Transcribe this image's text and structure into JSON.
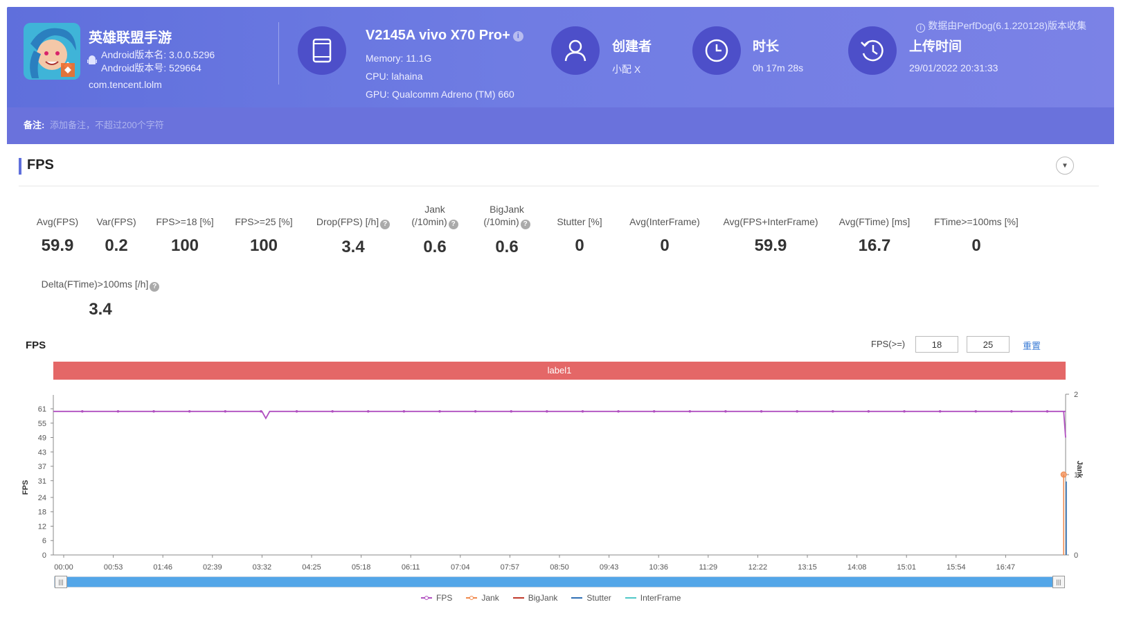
{
  "header": {
    "top_note": "数据由PerfDog(6.1.220128)版本收集",
    "app": {
      "name": "英雄联盟手游",
      "version_name": "Android版本名: 3.0.0.5296",
      "version_code": "Android版本号: 529664",
      "package": "com.tencent.lolm"
    },
    "device": {
      "name": "V2145A vivo X70 Pro+",
      "memory": "Memory: 11.1G",
      "cpu": "CPU: lahaina",
      "gpu": "GPU: Qualcomm Adreno (TM) 660"
    },
    "creator": {
      "title": "创建者",
      "value": "小配 X"
    },
    "duration": {
      "title": "时长",
      "value": "0h 17m 28s"
    },
    "upload": {
      "title": "上传时间",
      "value": "29/01/2022 20:31:33"
    },
    "remark_label": "备注:",
    "remark_placeholder": "添加备注，不超过200个字符"
  },
  "section": {
    "title": "FPS"
  },
  "metrics": [
    {
      "label": "Avg(FPS)",
      "value": "59.9"
    },
    {
      "label": "Var(FPS)",
      "value": "0.2"
    },
    {
      "label": "FPS>=18 [%]",
      "value": "100"
    },
    {
      "label": "FPS>=25 [%]",
      "value": "100"
    },
    {
      "label": "Drop(FPS) [/h]",
      "value": "3.4"
    },
    {
      "label": "Jank",
      "label2": "(/10min)",
      "value": "0.6"
    },
    {
      "label": "BigJank",
      "label2": "(/10min)",
      "value": "0.6"
    },
    {
      "label": "Stutter [%]",
      "value": "0"
    },
    {
      "label": "Avg(InterFrame)",
      "value": "0"
    },
    {
      "label": "Avg(FPS+InterFrame)",
      "value": "59.9"
    },
    {
      "label": "Avg(FTime) [ms]",
      "value": "16.7"
    },
    {
      "label": "FTime>=100ms [%]",
      "value": "0"
    },
    {
      "label": "Delta(FTime)>100ms [/h]",
      "value": "3.4"
    }
  ],
  "chart_panel": {
    "title": "FPS",
    "filter_label": "FPS(>=)",
    "filter_values": [
      "18",
      "25"
    ],
    "reset": "重置",
    "band_label": "label1"
  },
  "chart_data": {
    "type": "line",
    "ylabel": "FPS",
    "ylabel_right": "Jank",
    "y_ticks": [
      0,
      6,
      12,
      18,
      24,
      31,
      37,
      43,
      49,
      55,
      61
    ],
    "y_right_ticks": [
      0,
      1,
      2
    ],
    "ylim": [
      0,
      61
    ],
    "ylim_right": [
      0,
      2
    ],
    "x_ticks": [
      "00:00",
      "00:53",
      "01:46",
      "02:39",
      "03:32",
      "04:25",
      "05:18",
      "06:11",
      "07:04",
      "07:57",
      "08:50",
      "09:43",
      "10:36",
      "11:29",
      "12:22",
      "13:15",
      "14:08",
      "15:01",
      "15:54",
      "16:47"
    ],
    "x_range_seconds": [
      0,
      1048
    ],
    "series": [
      {
        "name": "FPS",
        "color": "#b04fc0",
        "baseline": 59.9,
        "dips": [
          [
            219,
            57
          ],
          [
            402,
            57
          ],
          [
            1046,
            49
          ]
        ],
        "end_value": 49
      },
      {
        "name": "Jank",
        "color": "#f0884a",
        "points": [
          [
            1046,
            1
          ]
        ]
      },
      {
        "name": "BigJank",
        "color": "#c0392b",
        "points": []
      },
      {
        "name": "Stutter",
        "color": "#2e6fb5",
        "points": []
      },
      {
        "name": "InterFrame",
        "color": "#4fc7c7",
        "points": []
      }
    ],
    "grid": false,
    "legend_position": "bottom"
  }
}
